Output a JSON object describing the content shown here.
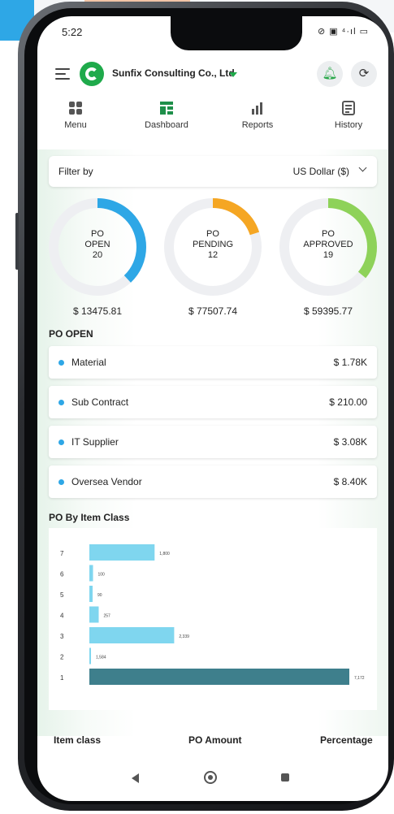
{
  "status_bar": {
    "time": "5:22",
    "icons_text": "⊘ ▣ ⁴·ıl ▭"
  },
  "app_bar": {
    "company": "Sunfix Consulting Co., Ltd"
  },
  "nav": [
    {
      "label": "Menu",
      "icon": "grid-icon"
    },
    {
      "label": "Dashboard",
      "icon": "dashboard-icon"
    },
    {
      "label": "Reports",
      "icon": "reports-icon"
    },
    {
      "label": "History",
      "icon": "history-icon"
    }
  ],
  "filter": {
    "label": "Filter by",
    "currency": "US Dollar ($)"
  },
  "summary": [
    {
      "line1": "PO",
      "line2": "OPEN",
      "count": "20",
      "amount": "$ 13475.81",
      "color": "#2ea7e6",
      "fraction": 0.38
    },
    {
      "line1": "PO",
      "line2": "PENDING",
      "count": "12",
      "amount": "$ 77507.74",
      "color": "#f5a623",
      "fraction": 0.2
    },
    {
      "line1": "PO",
      "line2": "APPROVED",
      "count": "19",
      "amount": "$ 59395.77",
      "color": "#8ed259",
      "fraction": 0.36
    }
  ],
  "po_open": {
    "title": "PO OPEN",
    "items": [
      {
        "name": "Material",
        "amount": "$ 1.78K"
      },
      {
        "name": "Sub Contract",
        "amount": "$ 210.00"
      },
      {
        "name": "IT Supplier",
        "amount": "$ 3.08K"
      },
      {
        "name": "Oversea Vendor",
        "amount": "$ 8.40K"
      }
    ]
  },
  "po_by_item_class": {
    "title": "PO By Item Class"
  },
  "chart_data": {
    "type": "bar",
    "orientation": "horizontal",
    "categories": [
      "7",
      "6",
      "5",
      "4",
      "3",
      "2",
      "1"
    ],
    "values": [
      1800,
      100,
      90,
      257,
      2339,
      1.584,
      7172
    ],
    "value_labels": [
      "1,800",
      "100",
      "90",
      "257",
      "2,339",
      "1,584",
      "7,172"
    ],
    "colors": [
      "#7fd6ef",
      "#7fd6ef",
      "#7fd6ef",
      "#7fd6ef",
      "#7fd6ef",
      "#7fd6ef",
      "#3e7f8c"
    ],
    "xlim": [
      0,
      7172
    ]
  },
  "table_headers": {
    "col1": "Item class",
    "col2": "PO Amount",
    "col3": "Percentage"
  }
}
